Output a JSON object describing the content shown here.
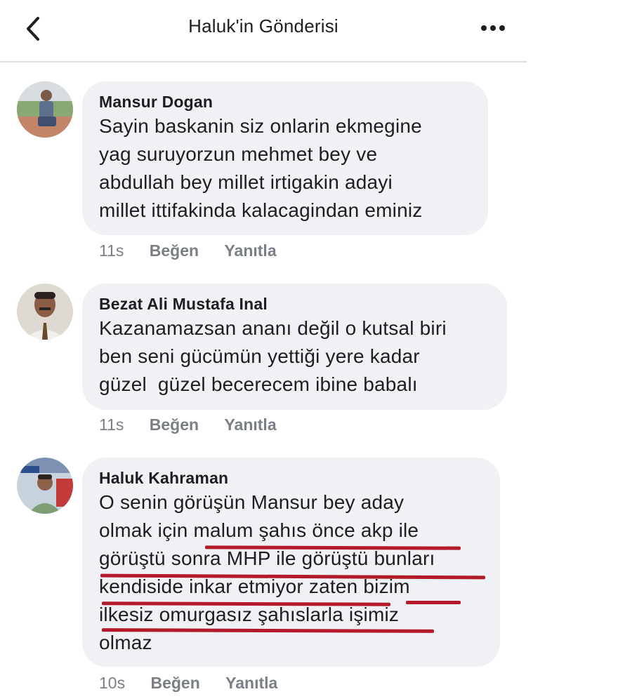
{
  "header": {
    "title": "Haluk'in Gönderisi"
  },
  "comments": [
    {
      "author": "Mansur Dogan",
      "text": "Sayin baskanin siz onlarin ekmegine\nyag suruyorzun mehmet bey ve\nabdullah bey millet irtigakin adayi\nmillet ittifakinda kalacagindan eminiz",
      "time": "11s",
      "like_label": "Beğen",
      "reply_label": "Yanıtla"
    },
    {
      "author": "Bezat Ali Mustafa Inal",
      "text": "Kazanamazsan ananı değil o kutsal biri\nben seni gücümün yettiği yere kadar\ngüzel  güzel becerecem ibine babalı",
      "time": "11s",
      "like_label": "Beğen",
      "reply_label": "Yanıtla"
    },
    {
      "author": "Haluk Kahraman",
      "text": "O senin görüşün Mansur bey aday\nolmak için malum şahıs önce akp ile\ngörüştü sonra MHP ile görüştü bunları\nkendiside inkar etmiyor zaten bizim\nilkesiz omurgasız şahıslarla işimiz\nolmaz",
      "time": "10s",
      "like_label": "Beğen",
      "reply_label": "Yanıtla"
    }
  ],
  "colors": {
    "bubble": "#f0f1f4",
    "meta_text": "#7a7f87",
    "underline": "#b21a2a"
  }
}
